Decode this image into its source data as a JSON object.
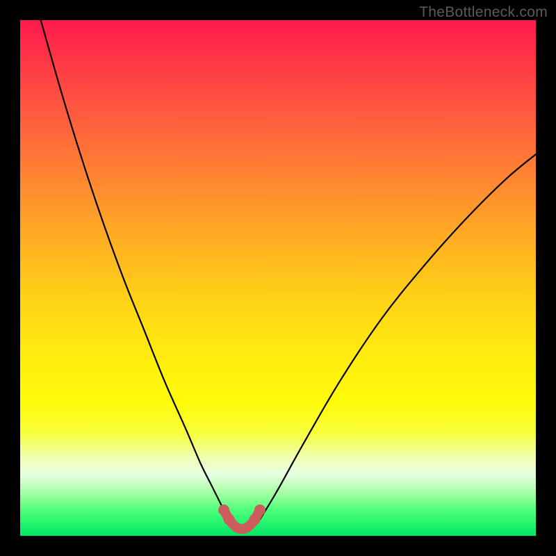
{
  "watermark": "TheBottleneck.com",
  "chart_data": {
    "type": "line",
    "title": "",
    "xlabel": "",
    "ylabel": "",
    "xlim": [
      0,
      100
    ],
    "ylim": [
      0,
      100
    ],
    "series": [
      {
        "name": "bottleneck-curve",
        "x": [
          4,
          8,
          12,
          16,
          20,
          24,
          28,
          32,
          35,
          37,
          39,
          40,
          41,
          42,
          43,
          44,
          45,
          46,
          47,
          50,
          55,
          62,
          70,
          78,
          86,
          94,
          100
        ],
        "values": [
          100,
          86,
          73,
          61,
          50,
          40,
          30,
          21,
          14,
          10,
          6,
          4,
          2.5,
          1.6,
          1.2,
          1.2,
          1.6,
          2.5,
          4,
          9,
          18,
          30,
          42,
          52,
          61,
          69,
          74
        ]
      },
      {
        "name": "highlight-segment",
        "x": [
          39.5,
          40.5,
          41.5,
          42.5,
          43.5,
          44.5,
          45.5,
          46.5
        ],
        "values": [
          5.0,
          3.2,
          2.0,
          1.4,
          1.4,
          2.0,
          3.2,
          5.0
        ]
      }
    ],
    "colors": {
      "curve": "#000000",
      "highlight": "#cd5c5c",
      "gradient_top": "#ff1a4d",
      "gradient_bottom": "#00e765"
    }
  }
}
